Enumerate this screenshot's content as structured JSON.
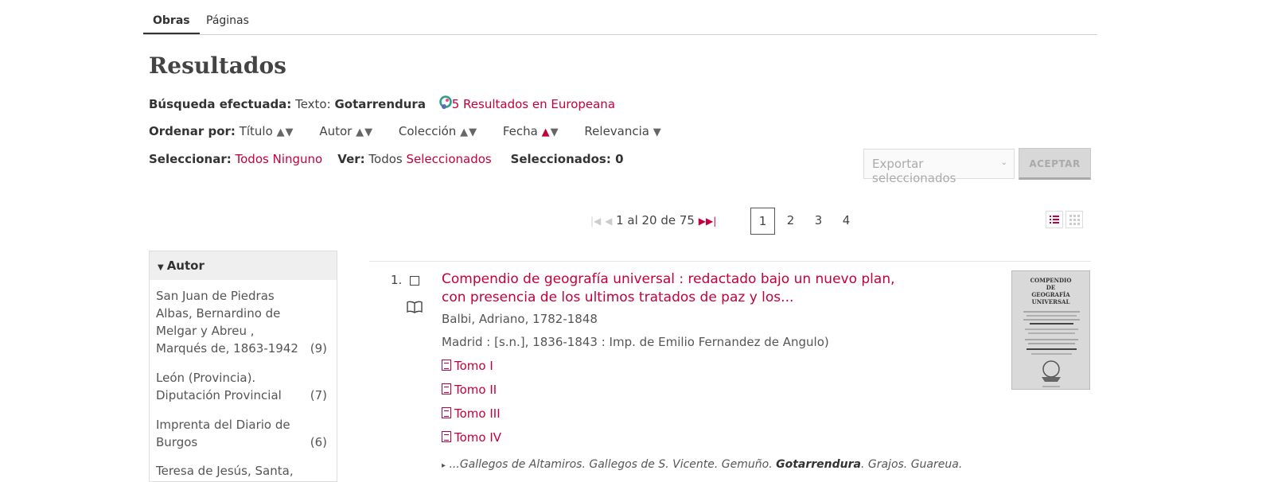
{
  "tabs": [
    {
      "label": "Obras",
      "active": true
    },
    {
      "label": "Páginas",
      "active": false
    }
  ],
  "page_title": "Resultados",
  "search": {
    "label": "Búsqueda efectuada:",
    "field": "Texto:",
    "term": "Gotarrendura",
    "europeana_link": "5 Resultados en Europeana"
  },
  "sort": {
    "label": "Ordenar por:",
    "options": [
      "Título",
      "Autor",
      "Colección",
      "Fecha",
      "Relevancia"
    ]
  },
  "select": {
    "label": "Seleccionar:",
    "all": "Todos",
    "none": "Ninguno",
    "view_label": "Ver:",
    "view_all": "Todos",
    "view_selected": "Seleccionados",
    "selected_count_label": "Seleccionados: 0"
  },
  "export": {
    "placeholder": "Exportar seleccionados",
    "accept_label": "ACEPTAR"
  },
  "pagination": {
    "summary": "1 al 20 de 75",
    "pages": [
      "1",
      "2",
      "3",
      "4"
    ],
    "current": "1"
  },
  "facet": {
    "title": "Autor",
    "items": [
      {
        "name": "San Juan de Piedras Albas, Bernardino de Melgar y Abreu , Marqués de, 1863-1942",
        "count": "(9)"
      },
      {
        "name": "León (Provincia). Diputación Provincial",
        "count": "(7)"
      },
      {
        "name": "Imprenta del Diario de Burgos",
        "count": "(6)"
      },
      {
        "name": "Teresa de Jesús, Santa,",
        "count": ""
      }
    ]
  },
  "result": {
    "number": "1.",
    "title": "Compendio de geografía universal : redactado bajo un nuevo plan, con presencia de los ultimos tratados de paz y los...",
    "author": "Balbi, Adriano, 1782-1848",
    "publication": "Madrid : [s.n.], 1836-1843 : Imp. de Emilio Fernandez de Angulo)",
    "volumes": [
      "Tomo I",
      "Tomo II",
      "Tomo III",
      "Tomo IV"
    ],
    "snippet_before": "...Gallegos de Altamiros. Gallegos de S. Vicente. Gemuño. ",
    "snippet_highlight": "Gotarrendura",
    "snippet_after": ". Grajos. Guareua.",
    "thumbnail_text": "COMPENDIO DE GEOGRAFÍA UNIVERSAL ... DON SEBASTIAN FABREGAS"
  },
  "colors": {
    "accent": "#c4003b",
    "text": "#444444",
    "border": "#dddddd"
  }
}
